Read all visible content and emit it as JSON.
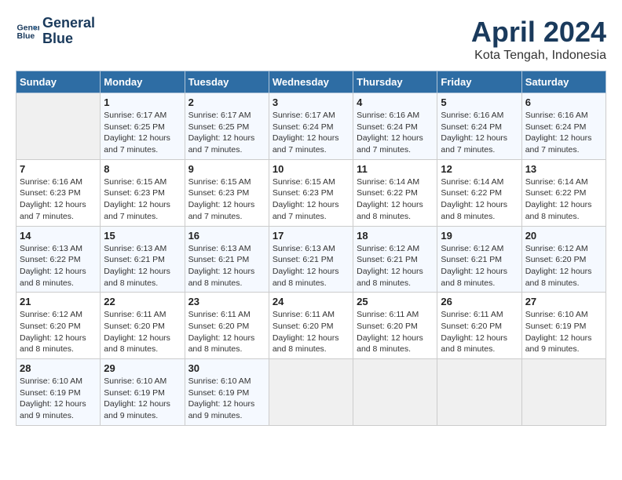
{
  "header": {
    "logo_line1": "General",
    "logo_line2": "Blue",
    "month": "April 2024",
    "location": "Kota Tengah, Indonesia"
  },
  "days_of_week": [
    "Sunday",
    "Monday",
    "Tuesday",
    "Wednesday",
    "Thursday",
    "Friday",
    "Saturday"
  ],
  "weeks": [
    [
      {
        "day": "",
        "sunrise": "",
        "sunset": "",
        "daylight": ""
      },
      {
        "day": "1",
        "sunrise": "Sunrise: 6:17 AM",
        "sunset": "Sunset: 6:25 PM",
        "daylight": "Daylight: 12 hours and 7 minutes."
      },
      {
        "day": "2",
        "sunrise": "Sunrise: 6:17 AM",
        "sunset": "Sunset: 6:25 PM",
        "daylight": "Daylight: 12 hours and 7 minutes."
      },
      {
        "day": "3",
        "sunrise": "Sunrise: 6:17 AM",
        "sunset": "Sunset: 6:24 PM",
        "daylight": "Daylight: 12 hours and 7 minutes."
      },
      {
        "day": "4",
        "sunrise": "Sunrise: 6:16 AM",
        "sunset": "Sunset: 6:24 PM",
        "daylight": "Daylight: 12 hours and 7 minutes."
      },
      {
        "day": "5",
        "sunrise": "Sunrise: 6:16 AM",
        "sunset": "Sunset: 6:24 PM",
        "daylight": "Daylight: 12 hours and 7 minutes."
      },
      {
        "day": "6",
        "sunrise": "Sunrise: 6:16 AM",
        "sunset": "Sunset: 6:24 PM",
        "daylight": "Daylight: 12 hours and 7 minutes."
      }
    ],
    [
      {
        "day": "7",
        "sunrise": "Sunrise: 6:16 AM",
        "sunset": "Sunset: 6:23 PM",
        "daylight": "Daylight: 12 hours and 7 minutes."
      },
      {
        "day": "8",
        "sunrise": "Sunrise: 6:15 AM",
        "sunset": "Sunset: 6:23 PM",
        "daylight": "Daylight: 12 hours and 7 minutes."
      },
      {
        "day": "9",
        "sunrise": "Sunrise: 6:15 AM",
        "sunset": "Sunset: 6:23 PM",
        "daylight": "Daylight: 12 hours and 7 minutes."
      },
      {
        "day": "10",
        "sunrise": "Sunrise: 6:15 AM",
        "sunset": "Sunset: 6:23 PM",
        "daylight": "Daylight: 12 hours and 7 minutes."
      },
      {
        "day": "11",
        "sunrise": "Sunrise: 6:14 AM",
        "sunset": "Sunset: 6:22 PM",
        "daylight": "Daylight: 12 hours and 8 minutes."
      },
      {
        "day": "12",
        "sunrise": "Sunrise: 6:14 AM",
        "sunset": "Sunset: 6:22 PM",
        "daylight": "Daylight: 12 hours and 8 minutes."
      },
      {
        "day": "13",
        "sunrise": "Sunrise: 6:14 AM",
        "sunset": "Sunset: 6:22 PM",
        "daylight": "Daylight: 12 hours and 8 minutes."
      }
    ],
    [
      {
        "day": "14",
        "sunrise": "Sunrise: 6:13 AM",
        "sunset": "Sunset: 6:22 PM",
        "daylight": "Daylight: 12 hours and 8 minutes."
      },
      {
        "day": "15",
        "sunrise": "Sunrise: 6:13 AM",
        "sunset": "Sunset: 6:21 PM",
        "daylight": "Daylight: 12 hours and 8 minutes."
      },
      {
        "day": "16",
        "sunrise": "Sunrise: 6:13 AM",
        "sunset": "Sunset: 6:21 PM",
        "daylight": "Daylight: 12 hours and 8 minutes."
      },
      {
        "day": "17",
        "sunrise": "Sunrise: 6:13 AM",
        "sunset": "Sunset: 6:21 PM",
        "daylight": "Daylight: 12 hours and 8 minutes."
      },
      {
        "day": "18",
        "sunrise": "Sunrise: 6:12 AM",
        "sunset": "Sunset: 6:21 PM",
        "daylight": "Daylight: 12 hours and 8 minutes."
      },
      {
        "day": "19",
        "sunrise": "Sunrise: 6:12 AM",
        "sunset": "Sunset: 6:21 PM",
        "daylight": "Daylight: 12 hours and 8 minutes."
      },
      {
        "day": "20",
        "sunrise": "Sunrise: 6:12 AM",
        "sunset": "Sunset: 6:20 PM",
        "daylight": "Daylight: 12 hours and 8 minutes."
      }
    ],
    [
      {
        "day": "21",
        "sunrise": "Sunrise: 6:12 AM",
        "sunset": "Sunset: 6:20 PM",
        "daylight": "Daylight: 12 hours and 8 minutes."
      },
      {
        "day": "22",
        "sunrise": "Sunrise: 6:11 AM",
        "sunset": "Sunset: 6:20 PM",
        "daylight": "Daylight: 12 hours and 8 minutes."
      },
      {
        "day": "23",
        "sunrise": "Sunrise: 6:11 AM",
        "sunset": "Sunset: 6:20 PM",
        "daylight": "Daylight: 12 hours and 8 minutes."
      },
      {
        "day": "24",
        "sunrise": "Sunrise: 6:11 AM",
        "sunset": "Sunset: 6:20 PM",
        "daylight": "Daylight: 12 hours and 8 minutes."
      },
      {
        "day": "25",
        "sunrise": "Sunrise: 6:11 AM",
        "sunset": "Sunset: 6:20 PM",
        "daylight": "Daylight: 12 hours and 8 minutes."
      },
      {
        "day": "26",
        "sunrise": "Sunrise: 6:11 AM",
        "sunset": "Sunset: 6:20 PM",
        "daylight": "Daylight: 12 hours and 8 minutes."
      },
      {
        "day": "27",
        "sunrise": "Sunrise: 6:10 AM",
        "sunset": "Sunset: 6:19 PM",
        "daylight": "Daylight: 12 hours and 9 minutes."
      }
    ],
    [
      {
        "day": "28",
        "sunrise": "Sunrise: 6:10 AM",
        "sunset": "Sunset: 6:19 PM",
        "daylight": "Daylight: 12 hours and 9 minutes."
      },
      {
        "day": "29",
        "sunrise": "Sunrise: 6:10 AM",
        "sunset": "Sunset: 6:19 PM",
        "daylight": "Daylight: 12 hours and 9 minutes."
      },
      {
        "day": "30",
        "sunrise": "Sunrise: 6:10 AM",
        "sunset": "Sunset: 6:19 PM",
        "daylight": "Daylight: 12 hours and 9 minutes."
      },
      {
        "day": "",
        "sunrise": "",
        "sunset": "",
        "daylight": ""
      },
      {
        "day": "",
        "sunrise": "",
        "sunset": "",
        "daylight": ""
      },
      {
        "day": "",
        "sunrise": "",
        "sunset": "",
        "daylight": ""
      },
      {
        "day": "",
        "sunrise": "",
        "sunset": "",
        "daylight": ""
      }
    ]
  ]
}
